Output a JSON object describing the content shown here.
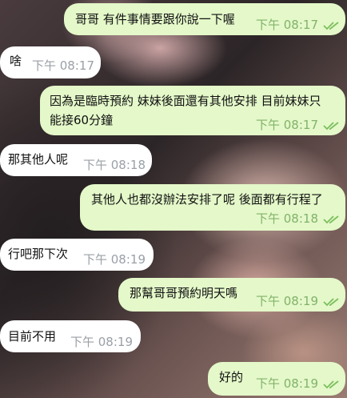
{
  "colors": {
    "incoming_bubble": "#ffffff",
    "outgoing_bubble": "#e4f8c9",
    "outgoing_time": "#82b26b",
    "incoming_time": "#9aa0a6",
    "read_check": "#7cbf5e"
  },
  "messages": [
    {
      "direction": "outgoing",
      "text": "哥哥 有件事情要跟你說一下喔",
      "time": "下午 08:17",
      "status_icon": "double-check-icon"
    },
    {
      "direction": "incoming",
      "text": "啥",
      "time": "下午 08:17"
    },
    {
      "direction": "outgoing",
      "text_line1": "因為是臨時預約 妹妹後面還有其他安排 目前妹妹只",
      "text_line2": "能接60分鐘",
      "time": "下午 08:17",
      "status_icon": "double-check-icon"
    },
    {
      "direction": "incoming",
      "text": "那其他人呢",
      "time": "下午 08:18"
    },
    {
      "direction": "outgoing",
      "text": "其他人也都沒辦法安排了呢 後面都有行程了",
      "time": "下午 08:18",
      "status_icon": "double-check-icon"
    },
    {
      "direction": "incoming",
      "text": "行吧那下次",
      "time": "下午 08:19"
    },
    {
      "direction": "outgoing",
      "text": "那幫哥哥預約明天嗎",
      "time": "下午 08:19",
      "status_icon": "double-check-icon"
    },
    {
      "direction": "incoming",
      "text": "目前不用",
      "time": "下午 08:19"
    },
    {
      "direction": "outgoing",
      "text": "好的",
      "time": "下午 08:19",
      "status_icon": "double-check-icon"
    }
  ]
}
